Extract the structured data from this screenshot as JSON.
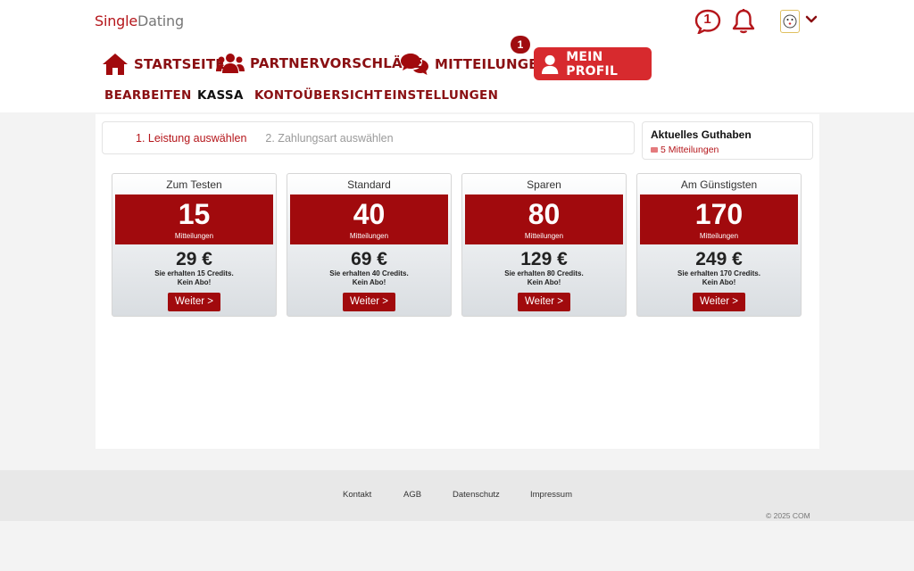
{
  "brand": {
    "part1": "Single",
    "part2": "Dating"
  },
  "header": {
    "chat_count": "1"
  },
  "nav": {
    "home": "STARTSEITE",
    "partner": "PARTNERVORSCHLÄGE",
    "messages": "MITTEILUNGEN",
    "messages_badge": "1",
    "profile": "MEIN PROFIL"
  },
  "subnav": {
    "edit": "BEARBEITEN",
    "checkout": "KASSA",
    "account": "KONTOÜBERSICHT",
    "settings": "EINSTELLUNGEN"
  },
  "steps": {
    "step1": "1. Leistung auswählen",
    "step2": "2. Zahlungsart auswählen"
  },
  "balance": {
    "title": "Aktuelles Guthaben",
    "value": "5 Mitteilungen"
  },
  "packages": [
    {
      "name": "Zum Testen",
      "qty": "15",
      "unit": "Mitteilungen",
      "price": "29 €",
      "info1": "Sie erhalten 15 Credits.",
      "info2": "Kein Abo!",
      "button": "Weiter >"
    },
    {
      "name": "Standard",
      "qty": "40",
      "unit": "Mitteilungen",
      "price": "69 €",
      "info1": "Sie erhalten 40 Credits.",
      "info2": "Kein Abo!",
      "button": "Weiter >"
    },
    {
      "name": "Sparen",
      "qty": "80",
      "unit": "Mitteilungen",
      "price": "129 €",
      "info1": "Sie erhalten 80 Credits.",
      "info2": "Kein Abo!",
      "button": "Weiter >"
    },
    {
      "name": "Am Günstigsten",
      "qty": "170",
      "unit": "Mitteilungen",
      "price": "249 €",
      "info1": "Sie erhalten 170 Credits.",
      "info2": "Kein Abo!",
      "button": "Weiter >"
    }
  ],
  "footer": {
    "contact": "Kontakt",
    "terms": "AGB",
    "privacy": "Datenschutz",
    "imprint": "Impressum",
    "copyright": "© 2025 COM"
  },
  "colors": {
    "brand_red": "#a10a0d",
    "accent_red": "#d72a2e"
  }
}
